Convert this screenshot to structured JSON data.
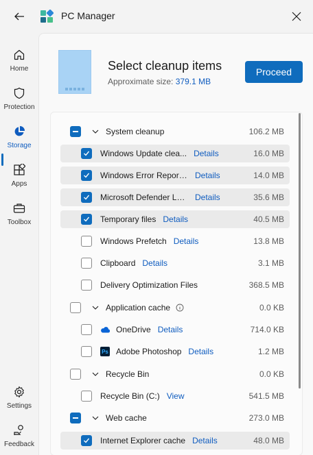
{
  "window": {
    "title": "PC Manager"
  },
  "sidebar": {
    "items": [
      {
        "label": "Home",
        "icon": "home-icon"
      },
      {
        "label": "Protection",
        "icon": "shield-icon"
      },
      {
        "label": "Storage",
        "icon": "pie-chart-icon",
        "active": true
      },
      {
        "label": "Apps",
        "icon": "apps-icon"
      },
      {
        "label": "Toolbox",
        "icon": "toolbox-icon"
      }
    ],
    "bottom": [
      {
        "label": "Settings",
        "icon": "gear-icon"
      },
      {
        "label": "Feedback",
        "icon": "feedback-icon"
      }
    ]
  },
  "header": {
    "title": "Select cleanup items",
    "approx_label": "Approximate size:",
    "approx_value": "379.1 MB",
    "proceed_label": "Proceed"
  },
  "colors": {
    "accent": "#0f6cbd",
    "link": "#0f5cbf"
  },
  "groups": [
    {
      "name": "System cleanup",
      "size": "106.2 MB",
      "state": "indeterminate",
      "items": [
        {
          "name": "Windows Update clea...",
          "link": "Details",
          "size": "16.0 MB",
          "checked": true
        },
        {
          "name": "Windows Error Report...",
          "link": "Details",
          "size": "14.0 MB",
          "checked": true
        },
        {
          "name": "Microsoft Defender Lo...",
          "link": "Details",
          "size": "35.6 MB",
          "checked": true
        },
        {
          "name": "Temporary files",
          "link": "Details",
          "size": "40.5 MB",
          "checked": true
        },
        {
          "name": "Windows Prefetch",
          "link": "Details",
          "size": "13.8 MB",
          "checked": false
        },
        {
          "name": "Clipboard",
          "link": "Details",
          "size": "3.1 MB",
          "checked": false
        },
        {
          "name": "Delivery Optimization Files",
          "link": "",
          "size": "368.5 MB",
          "checked": false
        }
      ]
    },
    {
      "name": "Application cache",
      "size": "0.0 KB",
      "state": "unchecked",
      "info": true,
      "items": [
        {
          "name": "OneDrive",
          "link": "Details",
          "size": "714.0 KB",
          "checked": false,
          "icon": "onedrive-icon"
        },
        {
          "name": "Adobe Photoshop",
          "link": "Details",
          "size": "1.2 MB",
          "checked": false,
          "icon": "photoshop-icon",
          "icon_text": "Ps"
        }
      ]
    },
    {
      "name": "Recycle Bin",
      "size": "0.0 KB",
      "state": "unchecked",
      "items": [
        {
          "name": "Recycle Bin (C:)",
          "link": "View",
          "size": "541.5 MB",
          "checked": false
        }
      ]
    },
    {
      "name": "Web cache",
      "size": "273.0 MB",
      "state": "indeterminate",
      "items": [
        {
          "name": "Internet Explorer cache",
          "link": "Details",
          "size": "48.0 MB",
          "checked": true
        }
      ]
    }
  ]
}
